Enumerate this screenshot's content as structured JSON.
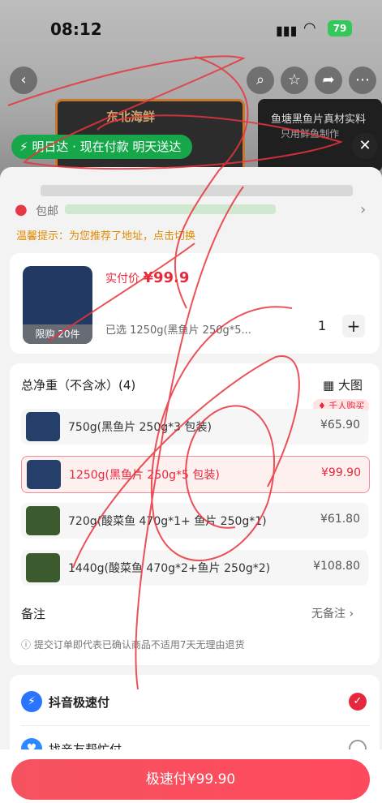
{
  "status": {
    "time": "08:12",
    "battery": "79"
  },
  "nav": {
    "back": "‹",
    "icons": [
      "search-icon",
      "star-icon",
      "share-icon",
      "more-icon"
    ]
  },
  "banners": {
    "left_title": "东北海鲜",
    "right_title": "鱼塘黑鱼片真材实料",
    "right_sub": "只用鲜鱼制作"
  },
  "delivery_pill": "明日达 · 现在付款 明天送达",
  "address": {
    "postage": "包邮",
    "tip": "温馨提示：为您推荐了地址，点击切换"
  },
  "product": {
    "limit": "限购 20件",
    "price_label": "实付价",
    "price": "¥99.9",
    "selected": "已选 1250g(黑鱼片 250g*5...",
    "quantity": "1",
    "plus": "+"
  },
  "options": {
    "header": "总净重（不含冰）(4)",
    "big_image": "大图",
    "badge": "千人购买",
    "items": [
      {
        "label": "750g(黑鱼片 250g*3 包装)",
        "price": "¥65.90"
      },
      {
        "label": "1250g(黑鱼片 250g*5 包装)",
        "price": "¥99.90"
      },
      {
        "label": "720g(酸菜鱼 470g*1+ 鱼片 250g*1)",
        "price": "¥61.80"
      },
      {
        "label": "1440g(酸菜鱼 470g*2+鱼片 250g*2)",
        "price": "¥108.80"
      }
    ],
    "selected_index": 1
  },
  "note": {
    "label": "备注",
    "value": "无备注",
    "disclaimer": "提交订单即代表已确认商品不适用7天无理由退货"
  },
  "payment": {
    "methods": [
      {
        "name": "抖音极速付",
        "selected": true
      },
      {
        "name": "找亲友帮忙付",
        "selected": false
      }
    ]
  },
  "footer": {
    "pay_button": "极速付¥99.90"
  },
  "colors": {
    "accent": "#e6283c",
    "green": "#15a74a",
    "warning": "#e08a00"
  }
}
